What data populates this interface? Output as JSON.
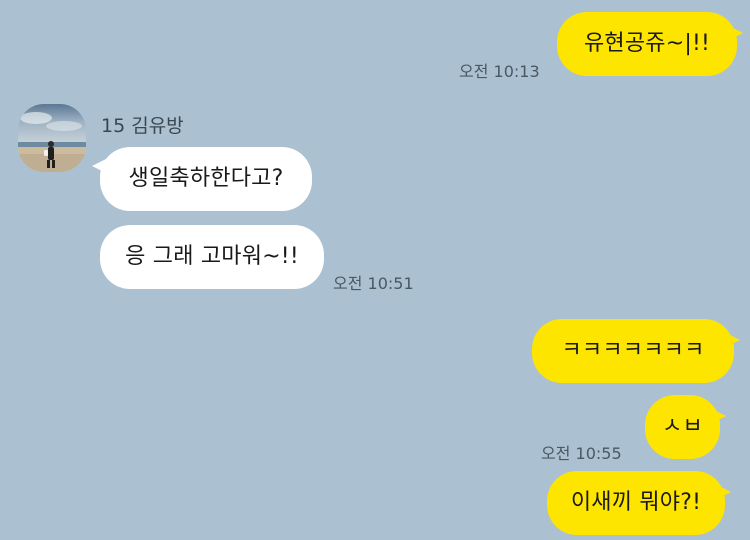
{
  "colors": {
    "background": "#abc1d1",
    "sent_bubble": "#fee500",
    "received_bubble": "#ffffff",
    "timestamp_text": "#4a5862"
  },
  "messages": [
    {
      "direction": "sent",
      "text": "유현공쥬~|!!",
      "time": "오전 10:13"
    },
    {
      "direction": "received",
      "sender": "15 김유방",
      "text": "생일축하한다고?"
    },
    {
      "direction": "received",
      "text": "응 그래 고마워~!!",
      "time": "오전 10:51"
    },
    {
      "direction": "sent",
      "text": "ㅋㅋㅋㅋㅋㅋㅋ"
    },
    {
      "direction": "sent",
      "text": "ㅅㅂ",
      "time": "오전 10:55"
    },
    {
      "direction": "sent",
      "text": "이새끼 뭐야?!"
    }
  ],
  "avatar": {
    "icon": "beach-profile-photo"
  }
}
